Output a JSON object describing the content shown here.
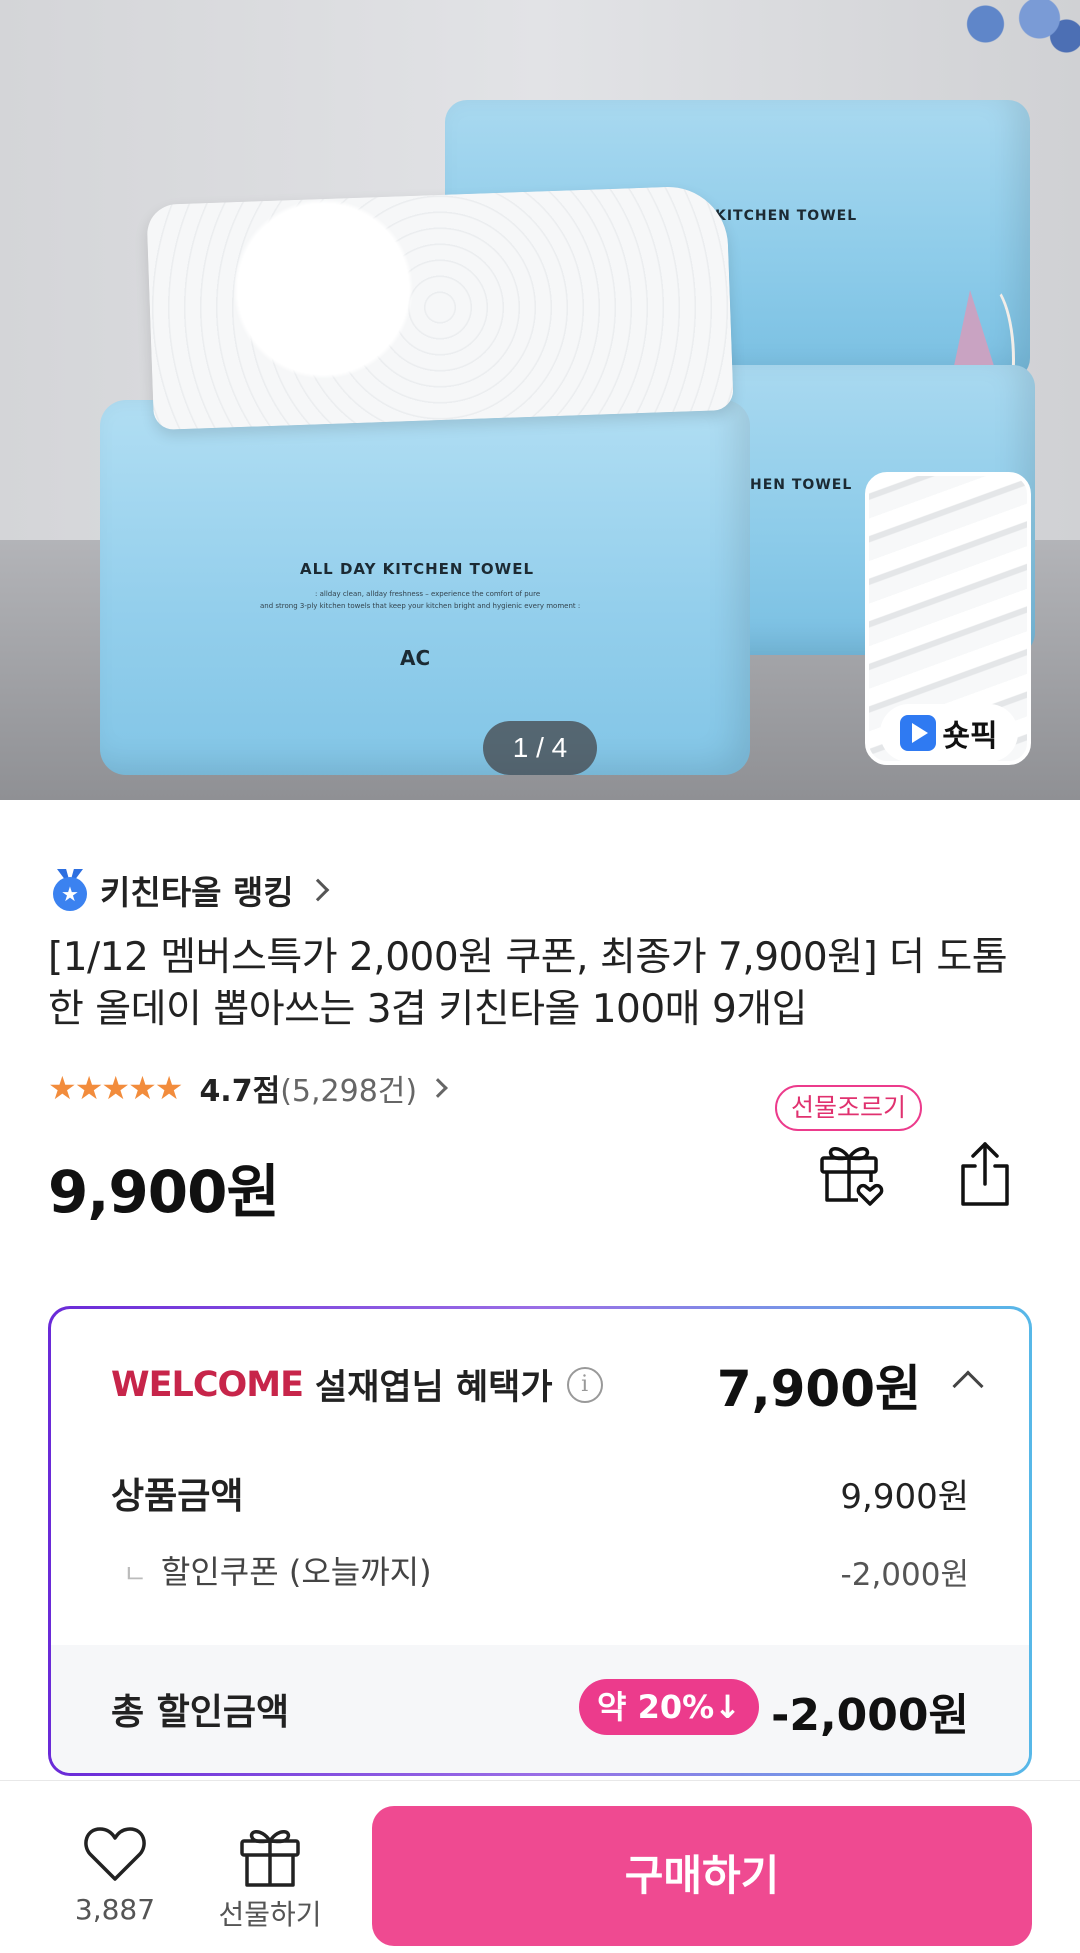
{
  "gallery": {
    "counter": "1 / 4",
    "product_print_title": "ALL DAY KITCHEN TOWEL",
    "product_print_title_back": "KITCHEN TOWEL",
    "product_print_title_back2": "HEN TOWEL",
    "product_print_small1": ": allday clean, allday freshness – experience the comfort of pure",
    "product_print_small2": "and strong 3-ply kitchen towels that keep your kitchen bright and hygienic every moment :",
    "product_print_logo": "AC",
    "shortpick_label": "숏픽"
  },
  "product": {
    "ranking_label": "키친타올 랭킹",
    "title": "[1/12 멤버스특가 2,000원 쿠폰, 최종가 7,900원] 더 도톰한 올데이 뽑아쓰는 3겹 키친타올 100매 9개입",
    "rating_stars": "★★★★★",
    "rating_score": "4.7점",
    "rating_count": "(5,298건)",
    "price": "9,900원",
    "gift_bubble": "선물조르기"
  },
  "benefit": {
    "welcome": "WELCOME",
    "member_text": "설재엽님 혜택가",
    "info_icon": "i",
    "benefit_price": "7,900원",
    "product_amount_label": "상품금액",
    "product_amount_value": "9,900원",
    "coupon_label": "할인쿠폰 (오늘까지)",
    "coupon_corner": "ㄴ",
    "coupon_value": "-2,000원",
    "total_label": "총 할인금액",
    "discount_badge": "약 20%↓",
    "total_value": "-2,000원"
  },
  "bottom_bar": {
    "like_count": "3,887",
    "gift_label": "선물하기",
    "buy_label": "구매하기"
  },
  "colors": {
    "accent_pink": "#ef4a91",
    "welcome_red": "#c7254a",
    "star_orange": "#f28c3c"
  },
  "icons": [
    "medal-icon",
    "chevron-right-icon",
    "gift-heart-icon",
    "share-icon",
    "info-icon",
    "chevron-up-icon",
    "heart-icon",
    "gift-icon",
    "play-icon"
  ]
}
